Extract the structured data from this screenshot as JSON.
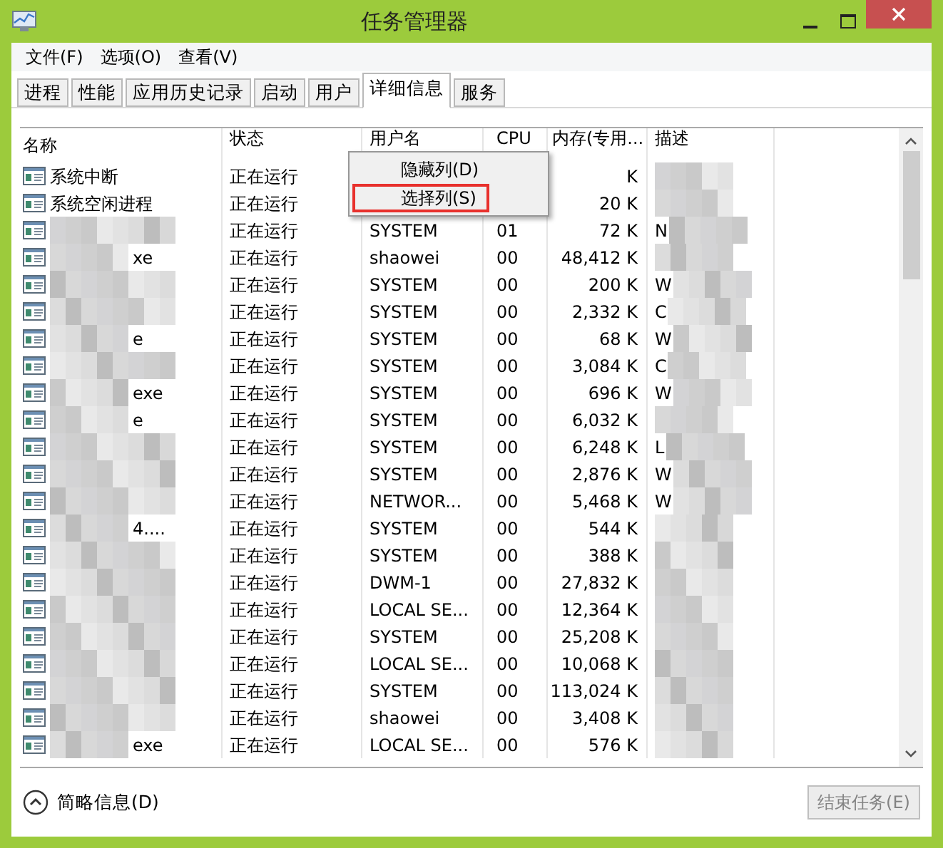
{
  "window": {
    "title": "任务管理器"
  },
  "menu": [
    "文件(F)",
    "选项(O)",
    "查看(V)"
  ],
  "tabs": [
    {
      "label": "进程",
      "selected": false
    },
    {
      "label": "性能",
      "selected": false
    },
    {
      "label": "应用历史记录",
      "selected": false
    },
    {
      "label": "启动",
      "selected": false
    },
    {
      "label": "用户",
      "selected": false
    },
    {
      "label": "详细信息",
      "selected": true
    },
    {
      "label": "服务",
      "selected": false
    }
  ],
  "table": {
    "columns": [
      "名称",
      "状态",
      "用户名",
      "CPU",
      "内存(专用...",
      "描述"
    ],
    "rows": [
      {
        "name": "系统中断",
        "redacted": false,
        "status": "正在运行",
        "user": "",
        "cpu": "",
        "memory": "K",
        "description": ""
      },
      {
        "name": "系统空闲进程",
        "redacted": false,
        "status": "正在运行",
        "user": "",
        "cpu": "",
        "memory": "20 K",
        "description": ""
      },
      {
        "name": "",
        "redacted": true,
        "status": "正在运行",
        "user": "SYSTEM",
        "cpu": "01",
        "memory": "72 K",
        "description": "N"
      },
      {
        "name": "xe",
        "redacted": true,
        "status": "正在运行",
        "user": "shaowei",
        "cpu": "00",
        "memory": "48,412 K",
        "description": ""
      },
      {
        "name": "",
        "redacted": true,
        "status": "正在运行",
        "user": "SYSTEM",
        "cpu": "00",
        "memory": "200 K",
        "description": "W"
      },
      {
        "name": "",
        "redacted": true,
        "status": "正在运行",
        "user": "SYSTEM",
        "cpu": "00",
        "memory": "2,332 K",
        "description": "C"
      },
      {
        "name": "e",
        "redacted": true,
        "status": "正在运行",
        "user": "SYSTEM",
        "cpu": "00",
        "memory": "68 K",
        "description": "W"
      },
      {
        "name": "",
        "redacted": true,
        "status": "正在运行",
        "user": "SYSTEM",
        "cpu": "00",
        "memory": "3,084 K",
        "description": "C"
      },
      {
        "name": "exe",
        "redacted": true,
        "status": "正在运行",
        "user": "SYSTEM",
        "cpu": "00",
        "memory": "696 K",
        "description": "W"
      },
      {
        "name": "e",
        "redacted": true,
        "status": "正在运行",
        "user": "SYSTEM",
        "cpu": "00",
        "memory": "6,032 K",
        "description": ""
      },
      {
        "name": "",
        "redacted": true,
        "status": "正在运行",
        "user": "SYSTEM",
        "cpu": "00",
        "memory": "6,248 K",
        "description": "L"
      },
      {
        "name": "",
        "redacted": true,
        "status": "正在运行",
        "user": "SYSTEM",
        "cpu": "00",
        "memory": "2,876 K",
        "description": "W"
      },
      {
        "name": "",
        "redacted": true,
        "status": "正在运行",
        "user": "NETWOR...",
        "cpu": "00",
        "memory": "5,468 K",
        "description": "W"
      },
      {
        "name": "4....",
        "redacted": true,
        "status": "正在运行",
        "user": "SYSTEM",
        "cpu": "00",
        "memory": "544 K",
        "description": ""
      },
      {
        "name": "",
        "redacted": true,
        "status": "正在运行",
        "user": "SYSTEM",
        "cpu": "00",
        "memory": "388 K",
        "description": ""
      },
      {
        "name": "",
        "redacted": true,
        "status": "正在运行",
        "user": "DWM-1",
        "cpu": "00",
        "memory": "27,832 K",
        "description": ""
      },
      {
        "name": "",
        "redacted": true,
        "status": "正在运行",
        "user": "LOCAL SE...",
        "cpu": "00",
        "memory": "12,364 K",
        "description": ""
      },
      {
        "name": "",
        "redacted": true,
        "status": "正在运行",
        "user": "SYSTEM",
        "cpu": "00",
        "memory": "25,208 K",
        "description": ""
      },
      {
        "name": "",
        "redacted": true,
        "status": "正在运行",
        "user": "LOCAL SE...",
        "cpu": "00",
        "memory": "10,068 K",
        "description": ""
      },
      {
        "name": "",
        "redacted": true,
        "status": "正在运行",
        "user": "SYSTEM",
        "cpu": "00",
        "memory": "113,024 K",
        "description": ""
      },
      {
        "name": "",
        "redacted": true,
        "status": "正在运行",
        "user": "shaowei",
        "cpu": "00",
        "memory": "3,408 K",
        "description": ""
      },
      {
        "name": "exe",
        "redacted": true,
        "status": "正在运行",
        "user": "LOCAL SE...",
        "cpu": "00",
        "memory": "576 K",
        "description": ""
      }
    ]
  },
  "context_menu": [
    {
      "label": "隐藏列(D)",
      "highlighted": false
    },
    {
      "label": "选择列(S)",
      "highlighted": true
    }
  ],
  "footer": {
    "details_toggle": "简略信息(D)",
    "end_task": {
      "label": "结束任务(E)",
      "disabled": true
    }
  }
}
